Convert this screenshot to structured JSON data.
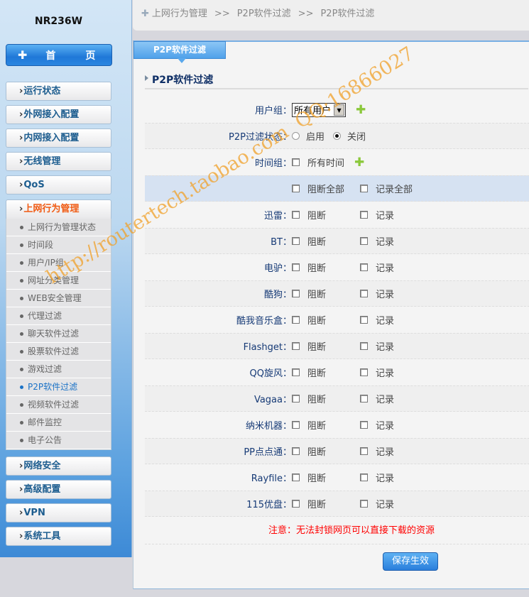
{
  "sidebar": {
    "model": "NR236W",
    "home": "首　页",
    "menu": [
      "运行状态",
      "外网接入配置",
      "内网接入配置",
      "无线管理",
      "QoS",
      "上网行为管理",
      "网络安全",
      "高级配置",
      "VPN",
      "系统工具"
    ],
    "submenu": [
      "上网行为管理状态",
      "时间段",
      "用户/IP组",
      "网址分类管理",
      "WEB安全管理",
      "代理过滤",
      "聊天软件过滤",
      "股票软件过滤",
      "游戏过滤",
      "P2P软件过滤",
      "视频软件过滤",
      "邮件监控",
      "电子公告"
    ],
    "active_submenu": "P2P软件过滤"
  },
  "breadcrumb": [
    "上网行为管理",
    ">>",
    "P2P软件过滤",
    ">>",
    "P2P软件过滤"
  ],
  "tab": "P2P软件过滤",
  "section_title": "P2P软件过滤",
  "form": {
    "user_group_label": "用户组：",
    "user_group_value": "所有用户",
    "status_label": "P2P过滤状态：",
    "status_on": "启用",
    "status_off": "关闭",
    "status_selected": "关闭",
    "time_group_label": "时间组：",
    "time_all": "所有时间",
    "block_all": "阻断全部",
    "log_all": "记录全部",
    "block": "阻断",
    "log": "记录",
    "apps": [
      "迅雷：",
      "BT：",
      "电驴：",
      "酷狗：",
      "酷我音乐盒：",
      "Flashget：",
      "QQ旋风：",
      "Vagaa：",
      "纳米机器：",
      "PP点点通：",
      "Rayfile：",
      "115优盘："
    ]
  },
  "notice": "注意：无法封锁网页可以直接下载的资源",
  "save_button": "保存生效",
  "watermark": "http://routertech.taobao.com  QQ:16866027"
}
